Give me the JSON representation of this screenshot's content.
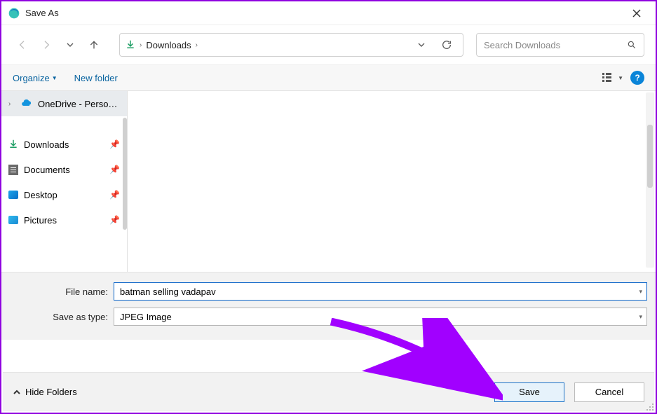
{
  "title": "Save As",
  "nav": {
    "location": "Downloads",
    "search_placeholder": "Search Downloads"
  },
  "toolbar": {
    "organize": "Organize",
    "new_folder": "New folder"
  },
  "sidebar": {
    "onedrive": "OneDrive - Personal",
    "items": [
      {
        "label": "Downloads",
        "icon": "download"
      },
      {
        "label": "Documents",
        "icon": "document"
      },
      {
        "label": "Desktop",
        "icon": "desktop"
      },
      {
        "label": "Pictures",
        "icon": "pictures"
      }
    ]
  },
  "form": {
    "filename_label": "File name:",
    "filename_value": "batman selling vadapav",
    "type_label": "Save as type:",
    "type_value": "JPEG Image"
  },
  "footer": {
    "hide_folders": "Hide Folders",
    "save": "Save",
    "cancel": "Cancel"
  }
}
